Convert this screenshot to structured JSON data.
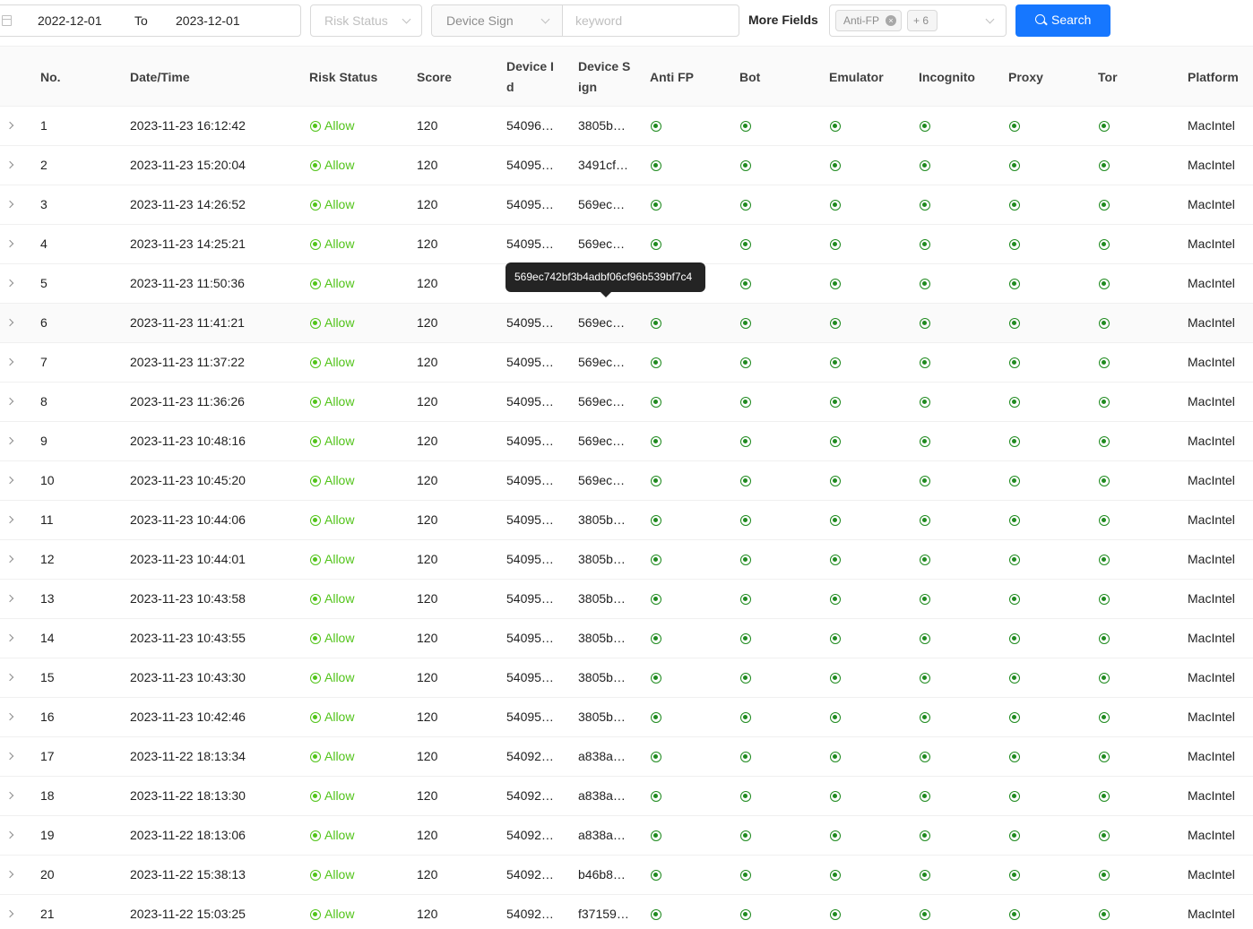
{
  "filters": {
    "date_from": "2022-12-01",
    "date_to_label": "To",
    "date_to": "2023-12-01",
    "risk_status_placeholder": "Risk Status",
    "device_field_selected": "Device Sign",
    "keyword_placeholder": "keyword",
    "more_fields_label": "More Fields",
    "more_fields_tags": [
      "Anti-FP",
      "+ 6"
    ],
    "search_label": "Search"
  },
  "table": {
    "columns": [
      {
        "key": "no",
        "label": "No."
      },
      {
        "key": "datetime",
        "label": "Date/Time"
      },
      {
        "key": "risk_status",
        "label": "Risk Status"
      },
      {
        "key": "score",
        "label": "Score"
      },
      {
        "key": "device_id",
        "label_line1": "Device I",
        "label_line2": "d"
      },
      {
        "key": "device_sign",
        "label_line1": "Device S",
        "label_line2": "ign"
      },
      {
        "key": "anti_fp",
        "label": "Anti FP"
      },
      {
        "key": "bot",
        "label": "Bot"
      },
      {
        "key": "emulator",
        "label": "Emulator"
      },
      {
        "key": "incognito",
        "label": "Incognito"
      },
      {
        "key": "proxy",
        "label": "Proxy"
      },
      {
        "key": "tor",
        "label": "Tor"
      },
      {
        "key": "platform",
        "label": "Platform"
      }
    ],
    "rows": [
      {
        "no": "1",
        "datetime": "2023-11-23 16:12:42",
        "status": "Allow",
        "score": "120",
        "device_id": "54096…",
        "device_sign": "3805b…",
        "platform": "MacIntel"
      },
      {
        "no": "2",
        "datetime": "2023-11-23 15:20:04",
        "status": "Allow",
        "score": "120",
        "device_id": "54095…",
        "device_sign": "3491cf…",
        "platform": "MacIntel"
      },
      {
        "no": "3",
        "datetime": "2023-11-23 14:26:52",
        "status": "Allow",
        "score": "120",
        "device_id": "54095…",
        "device_sign": "569ec…",
        "platform": "MacIntel"
      },
      {
        "no": "4",
        "datetime": "2023-11-23 14:25:21",
        "status": "Allow",
        "score": "120",
        "device_id": "54095…",
        "device_sign": "569ec…",
        "platform": "MacIntel"
      },
      {
        "no": "5",
        "datetime": "2023-11-23 11:50:36",
        "status": "Allow",
        "score": "120",
        "device_id": "",
        "device_sign": "",
        "platform": "MacIntel"
      },
      {
        "no": "6",
        "datetime": "2023-11-23 11:41:21",
        "status": "Allow",
        "score": "120",
        "device_id": "54095…",
        "device_sign": "569ec…",
        "platform": "MacIntel"
      },
      {
        "no": "7",
        "datetime": "2023-11-23 11:37:22",
        "status": "Allow",
        "score": "120",
        "device_id": "54095…",
        "device_sign": "569ec…",
        "platform": "MacIntel"
      },
      {
        "no": "8",
        "datetime": "2023-11-23 11:36:26",
        "status": "Allow",
        "score": "120",
        "device_id": "54095…",
        "device_sign": "569ec…",
        "platform": "MacIntel"
      },
      {
        "no": "9",
        "datetime": "2023-11-23 10:48:16",
        "status": "Allow",
        "score": "120",
        "device_id": "54095…",
        "device_sign": "569ec…",
        "platform": "MacIntel"
      },
      {
        "no": "10",
        "datetime": "2023-11-23 10:45:20",
        "status": "Allow",
        "score": "120",
        "device_id": "54095…",
        "device_sign": "569ec…",
        "platform": "MacIntel"
      },
      {
        "no": "11",
        "datetime": "2023-11-23 10:44:06",
        "status": "Allow",
        "score": "120",
        "device_id": "54095…",
        "device_sign": "3805b…",
        "platform": "MacIntel"
      },
      {
        "no": "12",
        "datetime": "2023-11-23 10:44:01",
        "status": "Allow",
        "score": "120",
        "device_id": "54095…",
        "device_sign": "3805b…",
        "platform": "MacIntel"
      },
      {
        "no": "13",
        "datetime": "2023-11-23 10:43:58",
        "status": "Allow",
        "score": "120",
        "device_id": "54095…",
        "device_sign": "3805b…",
        "platform": "MacIntel"
      },
      {
        "no": "14",
        "datetime": "2023-11-23 10:43:55",
        "status": "Allow",
        "score": "120",
        "device_id": "54095…",
        "device_sign": "3805b…",
        "platform": "MacIntel"
      },
      {
        "no": "15",
        "datetime": "2023-11-23 10:43:30",
        "status": "Allow",
        "score": "120",
        "device_id": "54095…",
        "device_sign": "3805b…",
        "platform": "MacIntel"
      },
      {
        "no": "16",
        "datetime": "2023-11-23 10:42:46",
        "status": "Allow",
        "score": "120",
        "device_id": "54095…",
        "device_sign": "3805b…",
        "platform": "MacIntel"
      },
      {
        "no": "17",
        "datetime": "2023-11-22 18:13:34",
        "status": "Allow",
        "score": "120",
        "device_id": "54092…",
        "device_sign": "a838a…",
        "platform": "MacIntel"
      },
      {
        "no": "18",
        "datetime": "2023-11-22 18:13:30",
        "status": "Allow",
        "score": "120",
        "device_id": "54092…",
        "device_sign": "a838a…",
        "platform": "MacIntel"
      },
      {
        "no": "19",
        "datetime": "2023-11-22 18:13:06",
        "status": "Allow",
        "score": "120",
        "device_id": "54092…",
        "device_sign": "a838a…",
        "platform": "MacIntel"
      },
      {
        "no": "20",
        "datetime": "2023-11-22 15:38:13",
        "status": "Allow",
        "score": "120",
        "device_id": "54092…",
        "device_sign": "b46b8…",
        "platform": "MacIntel"
      },
      {
        "no": "21",
        "datetime": "2023-11-22 15:03:25",
        "status": "Allow",
        "score": "120",
        "device_id": "54092…",
        "device_sign": "f37159…",
        "platform": "MacIntel"
      }
    ]
  },
  "tooltip": {
    "text": "569ec742bf3b4adbf06cf96b539bf7c4"
  },
  "colors": {
    "primary": "#1677ff",
    "allow_green": "#52c41a",
    "indicator_green": "#1f8a1f"
  },
  "icons": {
    "date": "calendar-icon",
    "search": "search-icon",
    "expand": "chevron-right-icon",
    "dropdown": "chevron-down-icon",
    "tag_remove": "close-circle-icon",
    "flag": "radio-dot-icon"
  }
}
